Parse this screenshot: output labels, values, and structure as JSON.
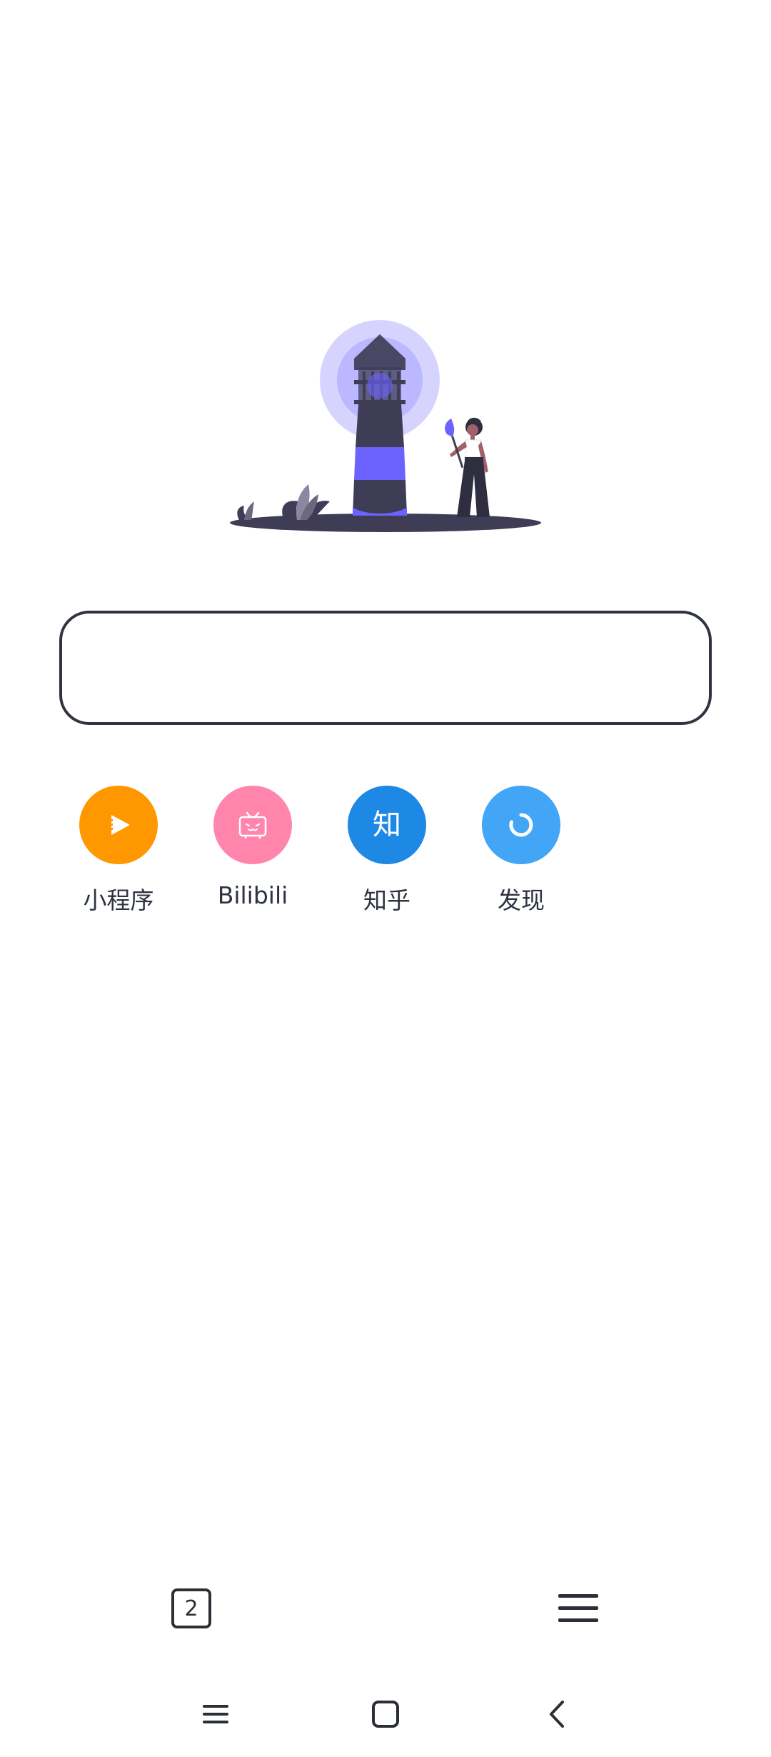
{
  "search": {
    "value": "",
    "placeholder": ""
  },
  "shortcuts": [
    {
      "label": "小程序",
      "icon": "play-icon",
      "color": "#FF9800"
    },
    {
      "label": "Bilibili",
      "icon": "tv-icon",
      "color": "#FF85AD"
    },
    {
      "label": "知乎",
      "icon": "zhihu-icon",
      "icon_text": "知",
      "color": "#1E88E5"
    },
    {
      "label": "发现",
      "icon": "discover-icon",
      "color": "#42A5F5"
    }
  ],
  "toolbar": {
    "tab_count": "2",
    "tabs_icon": "tabs-icon",
    "menu_icon": "menu-icon"
  },
  "system_nav": {
    "recents_icon": "recents-icon",
    "home_icon": "home-icon",
    "back_icon": "back-icon"
  },
  "colors": {
    "accent": "#6C63FF",
    "ink": "#2F2E41",
    "text": "#2D3340"
  }
}
